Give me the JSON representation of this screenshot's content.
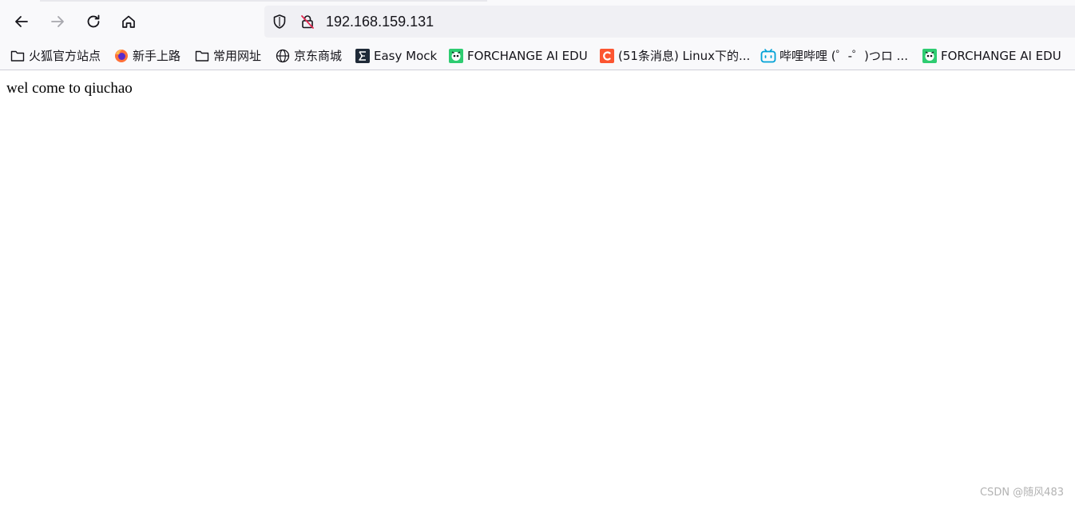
{
  "browser": {
    "url": "192.168.159.131",
    "nav": {
      "back_icon": "arrow-left-icon",
      "forward_icon": "arrow-right-icon",
      "reload_icon": "reload-icon",
      "home_icon": "home-icon"
    }
  },
  "bookmarks": [
    {
      "label": "火狐官方站点",
      "icon": "folder-icon"
    },
    {
      "label": "新手上路",
      "icon": "firefox-icon"
    },
    {
      "label": "常用网址",
      "icon": "folder-icon"
    },
    {
      "label": "京东商城",
      "icon": "globe-icon"
    },
    {
      "label": "Easy Mock",
      "icon": "easymock-icon"
    },
    {
      "label": "FORCHANGE AI EDU",
      "icon": "forchange-icon"
    },
    {
      "label": "(51条消息) Linux下的...",
      "icon": "csdn-icon"
    },
    {
      "label": "哔哩哔哩 (゜-゜)つロ ...",
      "icon": "bilibili-icon"
    },
    {
      "label": "FORCHANGE AI EDU",
      "icon": "forchange-icon"
    }
  ],
  "page": {
    "body_text": "wel come to qiuchao"
  },
  "watermark": "CSDN @随风483",
  "colors": {
    "toolbar_bg": "#f9f9fb",
    "urlbar_bg": "#f0f0f4",
    "text": "#15141a",
    "csdn": "#fc5531",
    "bilibili": "#00a1d6",
    "forchange": "#2ecc71",
    "easymock": "#1f2a38"
  }
}
